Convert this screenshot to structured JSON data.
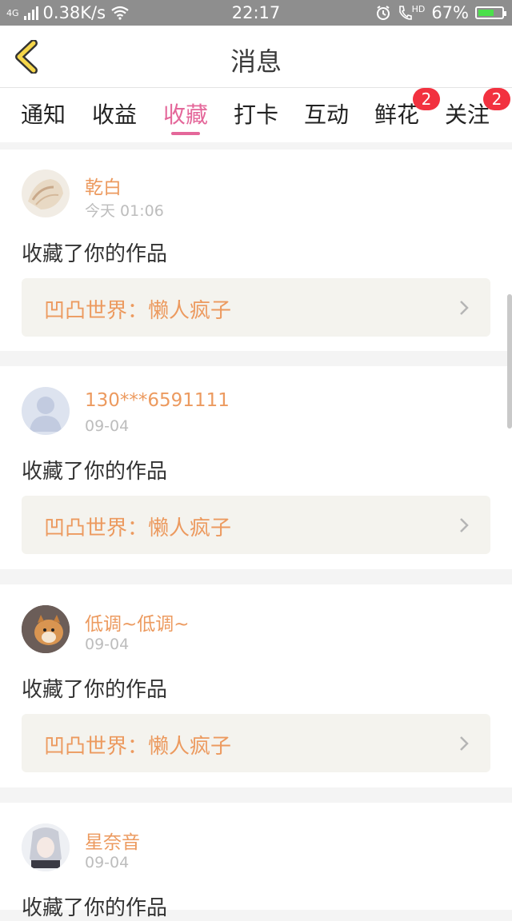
{
  "status_bar": {
    "network_type": "4G",
    "speed": "0.38K/s",
    "time": "22:17",
    "hd_label": "HD",
    "battery": "67%",
    "battery_level": 0.67
  },
  "header": {
    "title": "消息",
    "back_icon": "back-chevron-icon"
  },
  "tabs": [
    {
      "label": "通知",
      "badge": ""
    },
    {
      "label": "收益",
      "badge": ""
    },
    {
      "label": "收藏",
      "badge": "",
      "active": true
    },
    {
      "label": "打卡",
      "badge": ""
    },
    {
      "label": "互动",
      "badge": ""
    },
    {
      "label": "鲜花",
      "badge": "2"
    },
    {
      "label": "关注",
      "badge": "2"
    }
  ],
  "colors": {
    "accent": "#e4679a",
    "username": "#ec9a5f",
    "badge": "#f2313f",
    "back_icon": "#f5d64a"
  },
  "messages": [
    {
      "user": "乾白",
      "time": "今天 01:06",
      "action": "收藏了你的作品",
      "work": "凹凸世界：懒人疯子"
    },
    {
      "user": "130***6591111",
      "time": "09-04",
      "action": "收藏了你的作品",
      "work": "凹凸世界：懒人疯子"
    },
    {
      "user": "低调~低调~",
      "time": "09-04",
      "action": "收藏了你的作品",
      "work": "凹凸世界：懒人疯子"
    },
    {
      "user": "星奈音",
      "time": "09-04",
      "action": "收藏了你的作品",
      "work": ""
    }
  ]
}
